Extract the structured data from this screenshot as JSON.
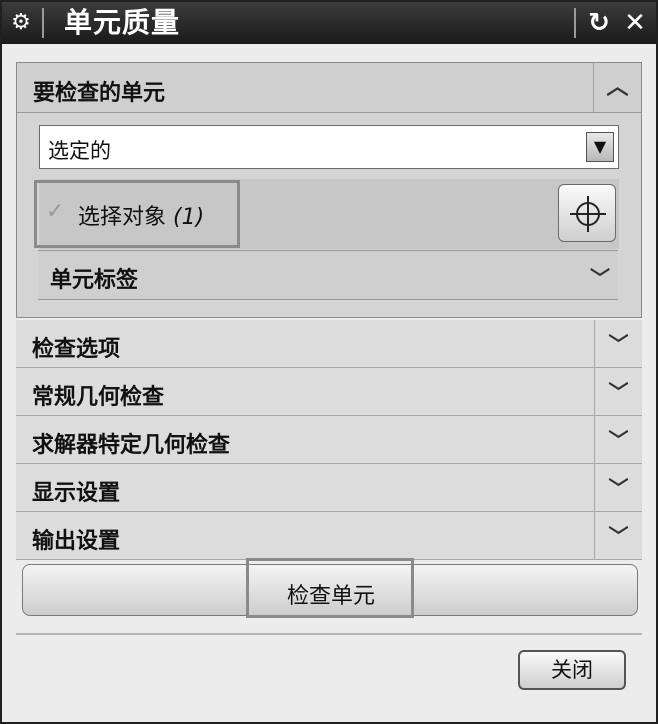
{
  "window": {
    "title": "单元质量",
    "gear_icon": "gear-icon",
    "reset_icon": "reset-icon",
    "close_icon": "close-icon"
  },
  "elements_to_check": {
    "label": "要检查的单元",
    "select_value": "选定的",
    "select_object_label": "选择对象",
    "select_object_count": "(1)",
    "element_labels_label": "单元标签"
  },
  "sections": [
    {
      "label": "检查选项"
    },
    {
      "label": "常规几何检查"
    },
    {
      "label": "求解器特定几何检查"
    },
    {
      "label": "显示设置"
    },
    {
      "label": "输出设置"
    }
  ],
  "check_button_label": "检查单元",
  "close_button_label": "关闭"
}
